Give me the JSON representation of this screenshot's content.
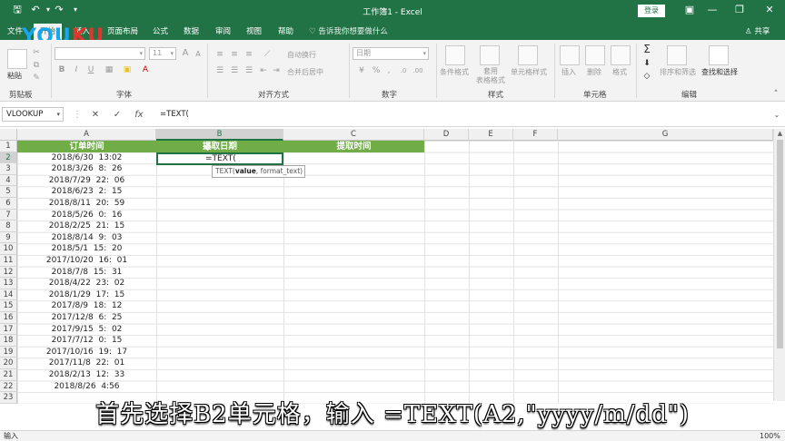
{
  "window": {
    "title": "工作簿1 - Excel",
    "login_label": "登录",
    "minimize": "—",
    "restore": "❐",
    "close": "✕",
    "ribbon_options": "▣"
  },
  "quick_access": {
    "save": "🖫",
    "undo": "↶",
    "redo": "↷",
    "customize": "▾"
  },
  "tabs": [
    "文件",
    "开始",
    "插入",
    "页面布局",
    "公式",
    "数据",
    "审阅",
    "视图",
    "帮助"
  ],
  "active_tab": "开始",
  "tell_me": "♡ 告诉我你想要做什么",
  "share": "♙ 共享",
  "watermark": {
    "y1": "YOU",
    "y2": "KU"
  },
  "ribbon": {
    "paste": "粘贴",
    "font_name": "",
    "font_size": "11",
    "wrap_text": "自动换行",
    "merge_center": "合并后居中",
    "number_format": "日期",
    "conditional_format": "条件格式",
    "format_as_table": "套用\n表格格式",
    "cell_styles": "单元格样式",
    "insert": "插入",
    "delete": "删除",
    "format": "格式",
    "sort_filter": "排序和筛选",
    "find_select": "查找和选择",
    "bold": "B",
    "italic": "I",
    "underline": "U",
    "font_grow": "A",
    "font_shrink": "A",
    "font_color": "A",
    "fill_icon": "▣",
    "border_icon": "▦",
    "currency": "¥",
    "percent": "%",
    "comma": ",",
    "autosum": "Σ",
    "groups": {
      "clipboard": "剪贴板",
      "font": "字体",
      "alignment": "对齐方式",
      "number": "数字",
      "styles": "样式",
      "cells": "单元格",
      "editing": "编辑"
    }
  },
  "formula_bar": {
    "name_box": "VLOOKUP",
    "cancel_icon": "✕",
    "enter_icon": "✓",
    "fx_icon": "fx",
    "content": "=TEXT("
  },
  "columns": [
    "A",
    "B",
    "C",
    "D",
    "E",
    "F",
    "G"
  ],
  "selected_column": "B",
  "rows": [
    "1",
    "2",
    "3",
    "4",
    "5",
    "6",
    "7",
    "8",
    "9",
    "10",
    "11",
    "12",
    "13",
    "14",
    "15",
    "16",
    "17",
    "18",
    "19",
    "20",
    "21",
    "22",
    "23"
  ],
  "selected_row": "2",
  "headers": {
    "a1": "订单时间",
    "b1": "提取日期",
    "c1": "提取时间"
  },
  "order_times": [
    "2018/6/30  13:02",
    "2018/3/26  8:  26",
    "2018/7/29  22:  06",
    "2018/6/23  2:  15",
    "2018/8/11  20:  59",
    "2018/5/26  0:  16",
    "2018/2/25  21:  15",
    "2018/8/14  9:  03",
    "2018/5/1  15:  20",
    "2017/10/20  16:  01",
    "2018/7/8  15:  31",
    "2018/4/22  23:  02",
    "2018/1/29  17:  15",
    "2017/8/9  18:  12",
    "2017/12/8  6:  25",
    "2017/9/15  5:  02",
    "2017/7/12  0:  15",
    "2017/10/16  19:  17",
    "2017/11/8  22:  01",
    "2018/2/13  12:  33",
    "2018/8/26  4:56"
  ],
  "active_cell_text": "=TEXT(",
  "tooltip": {
    "fn": "TEXT(",
    "arg1": "value",
    "rest": ", format_text)"
  },
  "status": {
    "mode": "输入",
    "zoom": "100%"
  },
  "subtitle": "首先选择B2单元格，输入 =TEXT(A2,\"yyyy/m/dd\")"
}
